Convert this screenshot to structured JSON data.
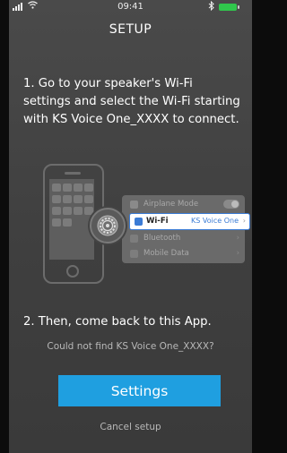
{
  "status_bar": {
    "time": "09:41",
    "bluetooth_icon": "bluetooth-icon",
    "battery_icon": "battery-icon",
    "battery_color": "#30c74c"
  },
  "header": {
    "title": "SETUP"
  },
  "instructions": {
    "step1": "1. Go to your speaker's Wi-Fi settings and select the Wi-Fi starting with KS Voice One_XXXX to connect.",
    "step2": "2. Then, come back to this App."
  },
  "illustration": {
    "menu": {
      "airplane_mode": "Airplane Mode",
      "wifi": "Wi-Fi",
      "wifi_network": "KS Voice One",
      "bluetooth": "Bluetooth",
      "mobile_data": "Mobile Data"
    },
    "icons": [
      "phone-icon",
      "settings-gear-icon",
      "airplane-icon",
      "wifi-icon",
      "bluetooth-icon",
      "mobile-data-icon"
    ]
  },
  "help_link": "Could not find KS Voice One_XXXX?",
  "buttons": {
    "settings": "Settings",
    "cancel": "Cancel setup"
  },
  "colors": {
    "accent": "#1f9fe0",
    "background": "#444444",
    "wifi_highlight": "#3a7bd5"
  }
}
